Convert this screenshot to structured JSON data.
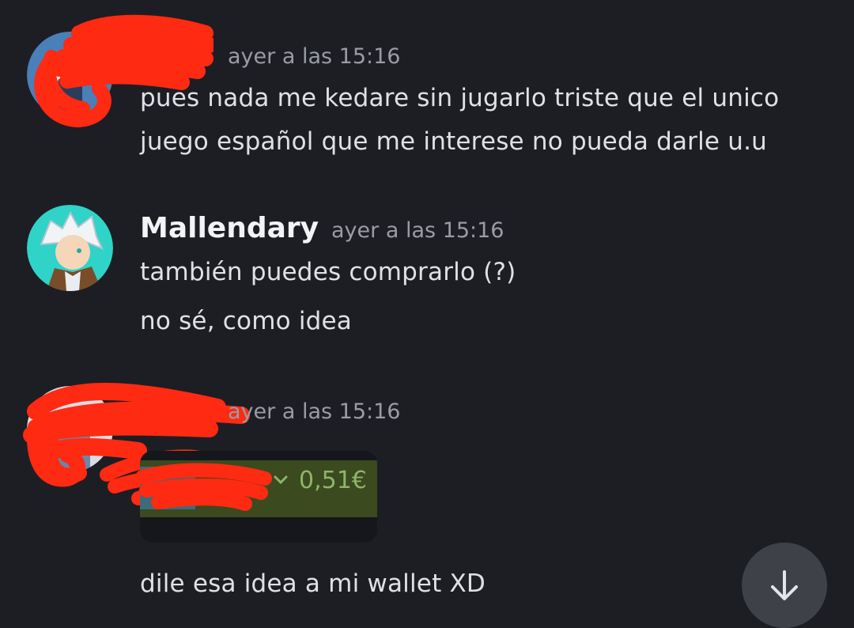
{
  "messages": [
    {
      "author": "",
      "timestamp": "ayer a las 15:16",
      "lines": [
        "pues nada me kedare sin jugarlo triste que el unico",
        "juego español que me interese no pueda darle u.u"
      ]
    },
    {
      "author": "Mallendary",
      "timestamp": "ayer a las 15:16",
      "lines": [
        "también puedes comprarlo (?)",
        "no sé, como idea"
      ]
    },
    {
      "author": "",
      "timestamp": "ayer a las 15:16",
      "embed": {
        "price": "0,51€"
      },
      "lines": [
        "dile esa idea a mi wallet XD"
      ]
    }
  ],
  "icons": {
    "scroll_down": "arrow-down-icon",
    "embed_chevron": "chevron-down-icon"
  },
  "colors": {
    "background": "#1d1e24",
    "redaction": "#ff2a12",
    "scroll_button": "#3f4148",
    "price": "#8fb36b",
    "avatar_mallendary_bg": "#2fd3c8"
  }
}
